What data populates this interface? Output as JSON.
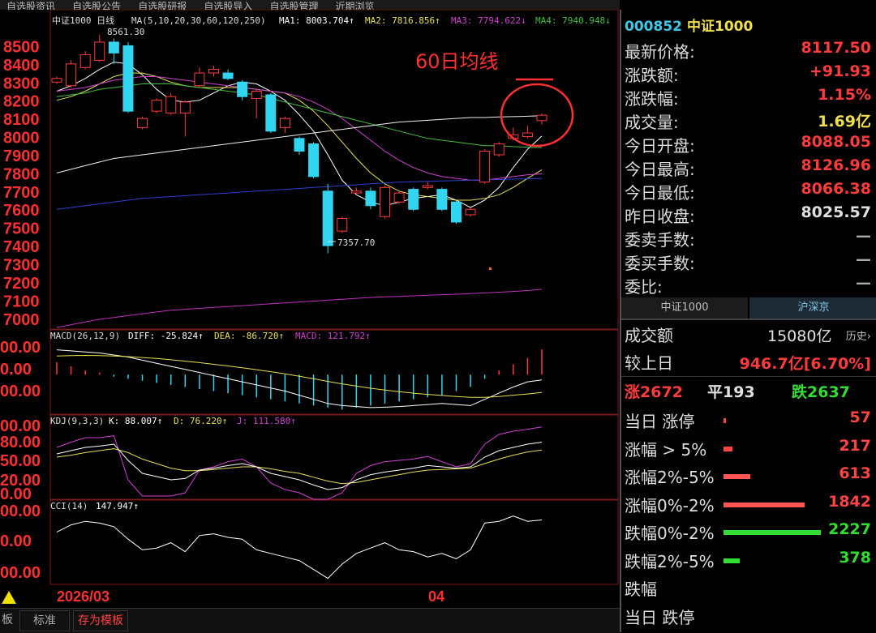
{
  "top_menu": [
    "自选股资讯",
    "自选股公告",
    "自选股研报",
    "自选股导入",
    "自选股管理",
    "近期浏览"
  ],
  "kline": {
    "header": "中证1000 日线",
    "ma_text": "MA(5,10,20,30,60,120,250)",
    "ma1": "MA1: 8003.704↑",
    "ma2": "MA2: 7816.856↑",
    "ma3": "MA3: 7794.622↓",
    "ma4": "MA4: 7940.948↓",
    "high_label": "8561.30",
    "low_label": "7357.70",
    "annotation": "60日均线",
    "y_ticks": [
      "8500",
      "8400",
      "8300",
      "8200",
      "8100",
      "8000",
      "7900",
      "7800",
      "7700",
      "7600",
      "7500",
      "7400",
      "7300",
      "7200",
      "7100",
      "7000"
    ]
  },
  "macd": {
    "title": "MACD(26,12,9)",
    "diff": "DIFF: -25.824↑",
    "dea": "DEA: -86.720↑",
    "macd": "MACD: 121.792↑",
    "y_ticks": [
      "00.00",
      "0.00",
      "00.00"
    ]
  },
  "kdj": {
    "title": "KDJ(9,3,3)",
    "k": "K: 88.007↑",
    "d": "D: 76.220↑",
    "j": "J: 111.580↑",
    "y_ticks": [
      "00.00",
      "80.00",
      "50.00",
      "20.00",
      "0.00"
    ]
  },
  "cci": {
    "title": "CCI(14)",
    "value": "147.947↑",
    "y_ticks": [
      "00.00",
      "0.00",
      "00.00"
    ]
  },
  "x_axis": {
    "left_date": "2026/03",
    "mid_label": "04"
  },
  "bottom_bar": {
    "tab1": "板",
    "tab2": "标准",
    "tab3": "存为模板"
  },
  "quote": {
    "code": "000852",
    "name": "中证1000",
    "rows": [
      {
        "label": "最新价格:",
        "value": "8117.50",
        "color": "#ff3b3b"
      },
      {
        "label": "涨跌额:",
        "value": "+91.93",
        "color": "#ff3b3b"
      },
      {
        "label": "涨跌幅:",
        "value": "1.15%",
        "color": "#ff3b3b"
      },
      {
        "label": "成交量:",
        "value": "1.69亿",
        "color": "#f0e050"
      },
      {
        "label": "今日开盘:",
        "value": "8088.05",
        "color": "#ff3b3b"
      },
      {
        "label": "今日最高:",
        "value": "8126.96",
        "color": "#ff3b3b"
      },
      {
        "label": "今日最低:",
        "value": "8066.38",
        "color": "#ff3b3b"
      },
      {
        "label": "昨日收盘:",
        "value": "8025.57",
        "color": "#e0e0e0"
      },
      {
        "label": "委卖手数:",
        "value": "—",
        "color": "#aaaaaa"
      },
      {
        "label": "委买手数:",
        "value": "—",
        "color": "#aaaaaa"
      },
      {
        "label": "委比:",
        "value": "—",
        "color": "#aaaaaa"
      }
    ]
  },
  "market_tabs": [
    "中证1000",
    "沪深京"
  ],
  "market": {
    "turnover_label": "成交额",
    "turnover_value": "15080亿",
    "history_label": "历史›",
    "vs_label": "较上日",
    "vs_value": "946.7亿[6.70%]",
    "up_label": "涨2672",
    "flat_label": "平193",
    "down_label": "跌2637",
    "breadth": [
      {
        "label": "当日 涨停",
        "value": "57",
        "fraction": 0.03,
        "color": "#ff4444",
        "val_color": "#ff4444"
      },
      {
        "label": "涨幅 > 5%",
        "value": "217",
        "fraction": 0.11,
        "color": "#ff4444",
        "val_color": "#ff4444"
      },
      {
        "label": "涨幅2%-5%",
        "value": "613",
        "fraction": 0.33,
        "color": "#ff5555",
        "val_color": "#ff4444"
      },
      {
        "label": "涨幅0%-2%",
        "value": "1842",
        "fraction": 1.0,
        "color": "#ff5555",
        "val_color": "#ff4444"
      },
      {
        "label": "跌幅0%-2%",
        "value": "2227",
        "fraction": 1.2,
        "color": "#33dd33",
        "val_color": "#33dd33"
      },
      {
        "label": "跌幅2%-5%",
        "value": "378",
        "fraction": 0.2,
        "color": "#33dd33",
        "val_color": "#33dd33"
      },
      {
        "label": "跌幅",
        "value": "",
        "fraction": 0.0,
        "color": "#33dd33",
        "val_color": "#33dd33"
      },
      {
        "label": "当日 跌停",
        "value": "",
        "fraction": 0.0,
        "color": "#33dd33",
        "val_color": "#33dd33"
      }
    ]
  },
  "chart_data": {
    "type": "candlestick",
    "ylim": [
      6950,
      8600
    ],
    "candles": [
      {
        "o": 8300,
        "c": 8320,
        "h": 8330,
        "l": 8290
      },
      {
        "o": 8280,
        "c": 8400,
        "h": 8420,
        "l": 8270
      },
      {
        "o": 8380,
        "c": 8450,
        "h": 8470,
        "l": 8370
      },
      {
        "o": 8420,
        "c": 8520,
        "h": 8561,
        "l": 8410
      },
      {
        "o": 8520,
        "c": 8460,
        "h": 8540,
        "l": 8400
      },
      {
        "o": 8500,
        "c": 8140,
        "h": 8520,
        "l": 8130
      },
      {
        "o": 8050,
        "c": 8100,
        "h": 8110,
        "l": 8040
      },
      {
        "o": 8140,
        "c": 8200,
        "h": 8210,
        "l": 8130
      },
      {
        "o": 8130,
        "c": 8220,
        "h": 8240,
        "l": 8120
      },
      {
        "o": 8130,
        "c": 8190,
        "h": 8200,
        "l": 8000
      },
      {
        "o": 8280,
        "c": 8350,
        "h": 8380,
        "l": 8270
      },
      {
        "o": 8350,
        "c": 8370,
        "h": 8390,
        "l": 8330
      },
      {
        "o": 8350,
        "c": 8320,
        "h": 8370,
        "l": 8310
      },
      {
        "o": 8300,
        "c": 8220,
        "h": 8310,
        "l": 8200
      },
      {
        "o": 8210,
        "c": 8250,
        "h": 8260,
        "l": 8100
      },
      {
        "o": 8230,
        "c": 8030,
        "h": 8240,
        "l": 8020
      },
      {
        "o": 8050,
        "c": 8100,
        "h": 8110,
        "l": 8020
      },
      {
        "o": 7990,
        "c": 7920,
        "h": 8000,
        "l": 7900
      },
      {
        "o": 7960,
        "c": 7780,
        "h": 7970,
        "l": 7770
      },
      {
        "o": 7700,
        "c": 7400,
        "h": 7740,
        "l": 7357.7
      },
      {
        "o": 7480,
        "c": 7550,
        "h": 7560,
        "l": 7470
      },
      {
        "o": 7690,
        "c": 7700,
        "h": 7720,
        "l": 7680
      },
      {
        "o": 7700,
        "c": 7620,
        "h": 7720,
        "l": 7600
      },
      {
        "o": 7560,
        "c": 7720,
        "h": 7730,
        "l": 7550
      },
      {
        "o": 7640,
        "c": 7690,
        "h": 7700,
        "l": 7630
      },
      {
        "o": 7710,
        "c": 7600,
        "h": 7720,
        "l": 7590
      },
      {
        "o": 7720,
        "c": 7730,
        "h": 7750,
        "l": 7710
      },
      {
        "o": 7710,
        "c": 7600,
        "h": 7720,
        "l": 7590
      },
      {
        "o": 7640,
        "c": 7530,
        "h": 7650,
        "l": 7520
      },
      {
        "o": 7570,
        "c": 7600,
        "h": 7610,
        "l": 7560
      },
      {
        "o": 7750,
        "c": 7920,
        "h": 7930,
        "l": 7740
      },
      {
        "o": 7900,
        "c": 7960,
        "h": 7970,
        "l": 7890
      },
      {
        "o": 7990,
        "c": 8010,
        "h": 8050,
        "l": 7980
      },
      {
        "o": 8000,
        "c": 8020,
        "h": 8060,
        "l": 7990
      },
      {
        "o": 8088.05,
        "c": 8117.5,
        "h": 8126.96,
        "l": 8066.38
      }
    ],
    "ma_lines": [
      {
        "name": "MA1",
        "color": "#ffffff",
        "values": [
          8250,
          8280,
          8320,
          8370,
          8410,
          8400,
          8340,
          8260,
          8200,
          8190,
          8200,
          8240,
          8280,
          8300,
          8290,
          8250,
          8200,
          8120,
          8030,
          7900,
          7760,
          7680,
          7640,
          7620,
          7640,
          7660,
          7670,
          7680,
          7650,
          7610,
          7650,
          7720,
          7830,
          7930,
          8003
        ]
      },
      {
        "name": "MA2",
        "color": "#e8e050",
        "values": [
          8200,
          8220,
          8250,
          8290,
          8330,
          8350,
          8350,
          8330,
          8300,
          8280,
          8270,
          8270,
          8270,
          8270,
          8260,
          8250,
          8240,
          8200,
          8140,
          8060,
          7970,
          7880,
          7800,
          7740,
          7700,
          7680,
          7670,
          7660,
          7650,
          7650,
          7660,
          7680,
          7720,
          7770,
          7817
        ]
      },
      {
        "name": "MA3",
        "color": "#d040d0",
        "values": [
          8250,
          8260,
          8270,
          8290,
          8310,
          8320,
          8330,
          8330,
          8320,
          8310,
          8300,
          8290,
          8280,
          8270,
          8260,
          8250,
          8240,
          8220,
          8190,
          8150,
          8100,
          8040,
          7980,
          7920,
          7870,
          7830,
          7800,
          7780,
          7770,
          7760,
          7760,
          7770,
          7780,
          7790,
          7795
        ]
      },
      {
        "name": "MA4",
        "color": "#40c040",
        "values": [
          8220,
          8230,
          8240,
          8260,
          8270,
          8280,
          8290,
          8290,
          8290,
          8280,
          8270,
          8260,
          8250,
          8240,
          8230,
          8210,
          8190,
          8170,
          8150,
          8130,
          8110,
          8090,
          8070,
          8050,
          8030,
          8010,
          7990,
          7980,
          7970,
          7960,
          7950,
          7950,
          7945,
          7942,
          7940
        ]
      },
      {
        "name": "MA120",
        "color": "#f0f0f0",
        "values": [
          7800,
          7820,
          7840,
          7860,
          7880,
          7890,
          7900,
          7910,
          7920,
          7930,
          7940,
          7950,
          7960,
          7970,
          7980,
          7990,
          8000,
          8010,
          8020,
          8030,
          8040,
          8050,
          8060,
          8070,
          8080,
          8085,
          8090,
          8095,
          8100,
          8105,
          8105,
          8108,
          8110,
          8112,
          8115
        ]
      },
      {
        "name": "MA250",
        "color": "#3040d0",
        "values": [
          7600,
          7610,
          7620,
          7630,
          7640,
          7650,
          7660,
          7665,
          7670,
          7675,
          7680,
          7685,
          7690,
          7695,
          7700,
          7705,
          7710,
          7715,
          7720,
          7725,
          7730,
          7735,
          7740,
          7745,
          7750,
          7752,
          7754,
          7756,
          7758,
          7760,
          7762,
          7764,
          7766,
          7768,
          7770
        ]
      },
      {
        "name": "MA_long",
        "color": "#c030c0",
        "values": [
          6950,
          6965,
          6980,
          6995,
          7005,
          7015,
          7025,
          7035,
          7045,
          7050,
          7055,
          7060,
          7065,
          7070,
          7075,
          7080,
          7085,
          7090,
          7095,
          7100,
          7105,
          7110,
          7115,
          7118,
          7121,
          7124,
          7127,
          7130,
          7133,
          7136,
          7140,
          7144,
          7148,
          7153,
          7160
        ]
      }
    ],
    "macd_hist": [
      60,
      40,
      20,
      10,
      -10,
      -20,
      -30,
      -40,
      -50,
      -60,
      -70,
      -80,
      -90,
      -100,
      -110,
      -120,
      -130,
      -140,
      -150,
      -160,
      -170,
      -160,
      -150,
      -140,
      -130,
      -120,
      -110,
      -100,
      -80,
      -60,
      -20,
      20,
      50,
      80,
      121.8
    ],
    "macd_diff": [
      120,
      115,
      110,
      105,
      95,
      85,
      70,
      55,
      40,
      25,
      10,
      -5,
      -20,
      -35,
      -50,
      -65,
      -80,
      -100,
      -120,
      -140,
      -150,
      -155,
      -160,
      -158,
      -155,
      -150,
      -145,
      -140,
      -145,
      -150,
      -120,
      -90,
      -60,
      -35,
      -25.8
    ],
    "macd_dea": [
      90,
      92,
      93,
      92,
      90,
      87,
      83,
      78,
      72,
      65,
      58,
      50,
      42,
      33,
      24,
      14,
      4,
      -8,
      -20,
      -33,
      -45,
      -56,
      -66,
      -75,
      -83,
      -90,
      -96,
      -101,
      -106,
      -110,
      -110,
      -106,
      -100,
      -94,
      -86.7
    ],
    "kdj_k": [
      70,
      75,
      80,
      82,
      85,
      60,
      40,
      35,
      30,
      32,
      45,
      48,
      52,
      55,
      50,
      40,
      35,
      30,
      22,
      15,
      18,
      30,
      38,
      42,
      45,
      48,
      52,
      50,
      48,
      50,
      65,
      75,
      80,
      85,
      88
    ],
    "kdj_d": [
      65,
      68,
      72,
      75,
      78,
      72,
      62,
      55,
      48,
      44,
      44,
      46,
      48,
      50,
      50,
      47,
      43,
      40,
      34,
      28,
      24,
      26,
      30,
      34,
      38,
      42,
      45,
      46,
      47,
      48,
      55,
      62,
      68,
      73,
      76
    ],
    "kdj_j": [
      80,
      88,
      95,
      95,
      98,
      30,
      5,
      5,
      5,
      10,
      45,
      50,
      58,
      62,
      50,
      25,
      15,
      10,
      0,
      0,
      10,
      40,
      52,
      58,
      60,
      62,
      66,
      58,
      50,
      55,
      85,
      100,
      105,
      108,
      111.6
    ],
    "cci": [
      80,
      120,
      140,
      130,
      110,
      40,
      -20,
      -10,
      20,
      -30,
      60,
      70,
      50,
      40,
      -20,
      -40,
      -60,
      -80,
      -130,
      -180,
      -100,
      -40,
      -10,
      20,
      -20,
      -30,
      -60,
      -40,
      -70,
      -20,
      130,
      140,
      170,
      140,
      147.9
    ]
  }
}
